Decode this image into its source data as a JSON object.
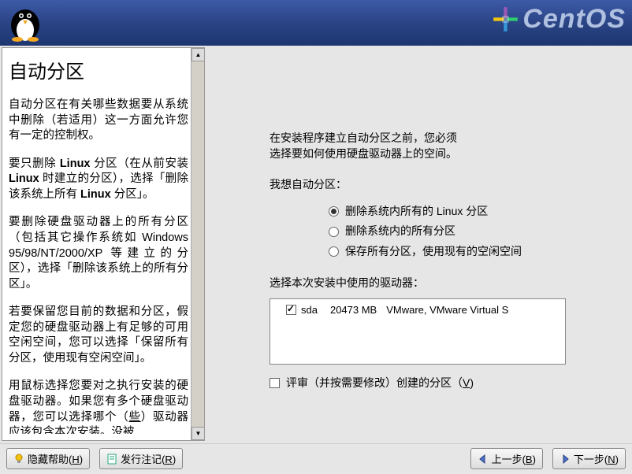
{
  "brand": "CentOS",
  "help": {
    "title": "自动分区",
    "paragraphs": [
      "自动分区在有关哪些数据要从系统中删除（若适用）这一方面允许您有一定的控制权。",
      "要只删除 Linux 分区（在从前安装 Linux 时建立的分区），选择「删除该系统上所有 Linux 分区」。",
      "要删除硬盘驱动器上的所有分区（包括其它操作系统如 Windows 95/98/NT/2000/XP 等建立的分区），选择「删除该系统上的所有分区」。",
      "若要保留您目前的数据和分区，假定您的硬盘驱动器上有足够的可用空闲空间，您可以选择「保留所有分区，使用现有空闲空间」。",
      "用鼠标选择您要对之执行安装的硬盘驱动器。如果您有多个硬盘驱动器，您可以选择哪个（些）驱动器应该包含本次安装。没被"
    ]
  },
  "main": {
    "intro1": "在安装程序建立自动分区之前，您必须",
    "intro2": "选择要如何使用硬盘驱动器上的空间。",
    "question": "我想自动分区：",
    "options": [
      "删除系统内所有的 Linux 分区",
      "删除系统内的所有分区",
      "保存所有分区，使用现有的空闲空间"
    ],
    "selected": 0,
    "drivesLabel": "选择本次安装中使用的驱动器：",
    "drive": {
      "name": "sda",
      "size": "20473 MB",
      "model": "VMware, VMware Virtual S"
    },
    "reviewLabel": "评审（并按需要修改）创建的分区（",
    "reviewKey": "V",
    "reviewEnd": ")"
  },
  "footer": {
    "hideHelp": "隐藏帮助(",
    "hideHelpKey": "H",
    "release": "发行注记(",
    "releaseKey": "R",
    "back": "上一步(",
    "backKey": "B",
    "next": "下一步(",
    "nextKey": "N",
    "close": ")"
  }
}
